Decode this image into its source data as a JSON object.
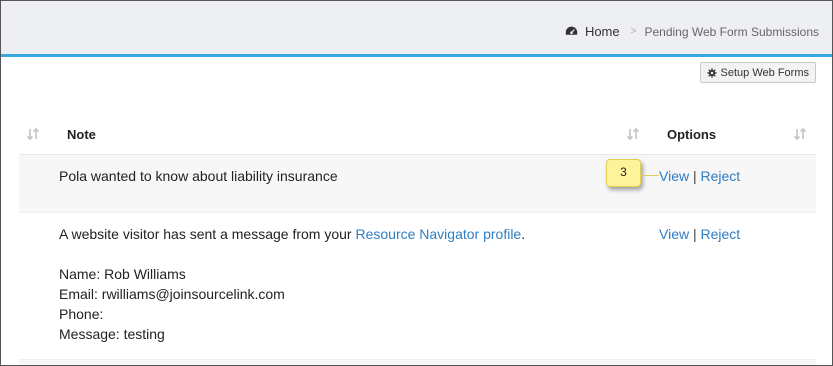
{
  "breadcrumb": {
    "home": "Home",
    "separator": ">",
    "current": "Pending Web Form Submissions"
  },
  "toolbar": {
    "setup_label": "Setup Web Forms",
    "setup_icon": "gear-icon"
  },
  "table": {
    "columns": [
      "Note",
      "Options"
    ],
    "rows": [
      {
        "note": "Pola wanted to know about liability insurance",
        "view": "View",
        "divider": "|",
        "reject": "Reject"
      },
      {
        "note_intro": "A website visitor has sent a message from your ",
        "note_link": "Resource Navigator profile",
        "note_period": ".",
        "name_line": "Name: Rob Williams",
        "email_line": "Email: rwilliams@joinsourcelink.com",
        "phone_line": "Phone:",
        "message_line": "Message: testing",
        "view": "View",
        "divider": "|",
        "reject": "Reject"
      }
    ]
  },
  "callout": {
    "number": "3"
  },
  "colors": {
    "accent": "#35a8df",
    "link": "#2f7dc2",
    "callout_bg": "#fdf39a"
  }
}
